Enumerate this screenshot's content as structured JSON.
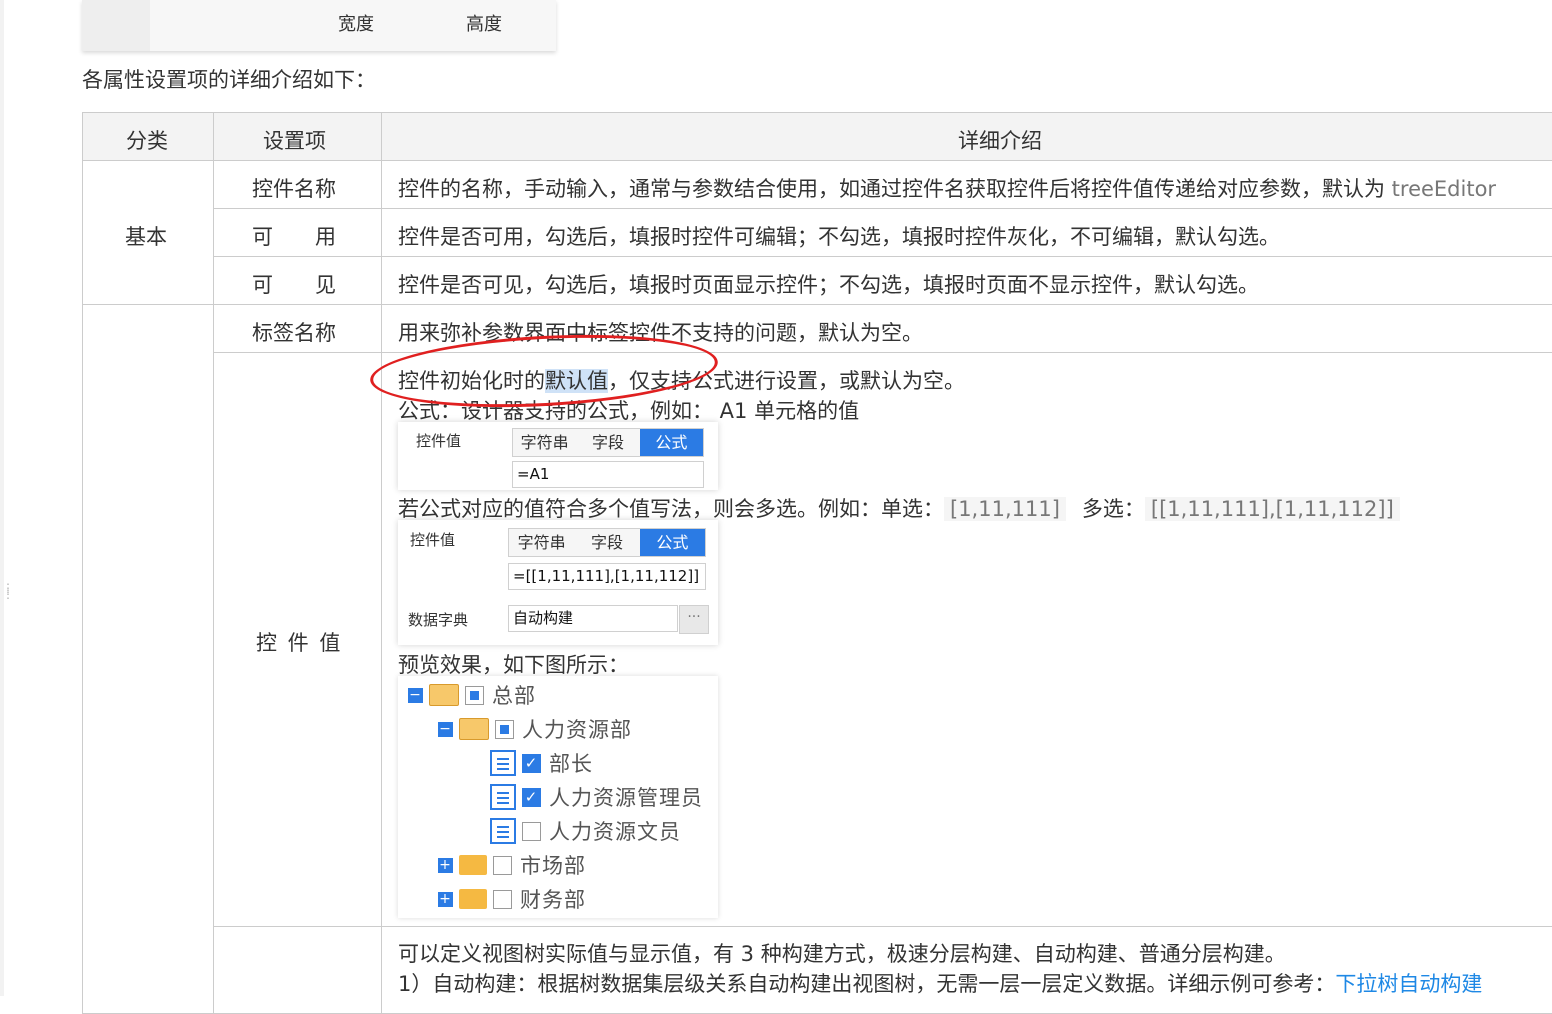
{
  "top_panel": {
    "width_label": "宽度",
    "height_label": "高度"
  },
  "intro": "各属性设置项的详细介绍如下：",
  "table": {
    "headers": [
      "分类",
      "设置项",
      "详细介绍"
    ],
    "group_basic": "基本",
    "rows": {
      "name": {
        "item": "控件名称",
        "desc": "控件的名称，手动输入，通常与参数结合使用，如通过控件名获取控件后将控件值传递给对应参数，默认为 ",
        "code": "treeEditor"
      },
      "enabled": {
        "item": "可　　用",
        "desc": "控件是否可用，勾选后，填报时控件可编辑；不勾选，填报时控件灰化，不可编辑，默认勾选。"
      },
      "visible": {
        "item": "可　　见",
        "desc": "控件是否可见，勾选后，填报时页面显示控件；不勾选，填报时页面不显示控件，默认勾选。"
      },
      "label": {
        "item": "标签名称",
        "desc": "用来弥补参数界面中标签控件不支持的问题，默认为空。"
      },
      "value": {
        "item": "控 件 值",
        "line1_pre": "控件初始化时的",
        "line1_hl": "默认值",
        "line1_post": "，仅支持公式进行设置，或默认为空。",
        "line2": "公式：设计器支持的公式，例如： A1 单元格的值",
        "line3_pre": "若公式对应的值符合多个值写法，则会多选。例如：单选：",
        "line3_single": "[1,11,111]",
        "line3_mid": "多选：",
        "line3_multi": "[[1,11,111],[1,11,112]]",
        "line4": "预览效果，如下图所示：",
        "panel1": {
          "label": "控件值",
          "tabs": [
            "字符串",
            "字段",
            "公式"
          ],
          "value": "=A1"
        },
        "panel2": {
          "label": "控件值",
          "tabs": [
            "字符串",
            "字段",
            "公式"
          ],
          "value": "=[[1,11,111],[1,11,112]]",
          "dict_label": "数据字典",
          "dict_value": "自动构建",
          "more": "···"
        },
        "tree": [
          "总部",
          "人力资源部",
          "部长",
          "人力资源管理员",
          "人力资源文员",
          "市场部",
          "财务部"
        ]
      },
      "data_dict": {
        "line1": "可以定义视图树实际值与显示值，有 3 种构建方式，极速分层构建、自动构建、普通分层构建。",
        "line2_pre": "1）自动构建：根据树数据集层级关系自动构建出视图树，无需一层一层定义数据。详细示例可参考：",
        "line2_link": "下拉树自动构建"
      }
    }
  }
}
